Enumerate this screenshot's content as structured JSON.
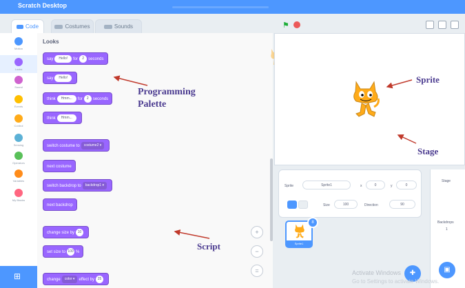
{
  "window": {
    "title": "Scratch Desktop"
  },
  "tabs": [
    {
      "label": "Code"
    },
    {
      "label": "Costumes"
    },
    {
      "label": "Sounds"
    }
  ],
  "categories": [
    {
      "label": "Motion",
      "color": "#4c97ff"
    },
    {
      "label": "Looks",
      "color": "#9966ff"
    },
    {
      "label": "Sound",
      "color": "#cf63cf"
    },
    {
      "label": "Events",
      "color": "#ffbf00"
    },
    {
      "label": "Control",
      "color": "#ffab19"
    },
    {
      "label": "Sensing",
      "color": "#5cb1d6"
    },
    {
      "label": "Operators",
      "color": "#59c059"
    },
    {
      "label": "Variables",
      "color": "#ff8c1a"
    },
    {
      "label": "My Blocks",
      "color": "#ff6680"
    }
  ],
  "palette": {
    "heading": "Looks",
    "blocks": [
      {
        "pre": "say",
        "v1": "Hello!",
        "mid": "for",
        "v2": "2",
        "post": "seconds"
      },
      {
        "pre": "say",
        "v1": "Hello!"
      },
      {
        "pre": "think",
        "v1": "Hmm...",
        "mid": "for",
        "v2": "2",
        "post": "seconds"
      },
      {
        "pre": "think",
        "v1": "Hmm..."
      },
      {
        "pre": "switch costume to",
        "drop": "costume2 ▾"
      },
      {
        "pre": "next costume"
      },
      {
        "pre": "switch backdrop to",
        "drop": "backdrop1 ▾"
      },
      {
        "pre": "next backdrop"
      },
      {
        "pre": "change size by",
        "v2": "10"
      },
      {
        "pre": "set size to",
        "v2": "100",
        "post": "%"
      },
      {
        "pre": "change",
        "drop": "color ▾",
        "mid": "effect by",
        "v2": "25"
      }
    ]
  },
  "zoom": {
    "in": "+",
    "out": "−",
    "reset": "="
  },
  "sprite_info": {
    "sprite_label": "Sprite",
    "sprite_name": "Sprite1",
    "x_label": "x",
    "x_value": "0",
    "y_label": "y",
    "y_value": "0",
    "show_label": "Show",
    "size_label": "Size",
    "size_value": "100",
    "direction_label": "Direction",
    "direction_value": "90"
  },
  "sprite_list": {
    "thumb_name": "Sprite1",
    "badge": "8"
  },
  "stage_panel": {
    "label": "Stage",
    "backdrops_label": "Backdrops",
    "backdrops_count": "1"
  },
  "annotations": {
    "palette_line1": "Programming",
    "palette_line2": "Palette",
    "sprite": "Sprite",
    "stage": "Stage",
    "script": "Script"
  },
  "watermark": {
    "line1": "Activate Windows",
    "line2": "Go to Settings to activate Windows."
  }
}
